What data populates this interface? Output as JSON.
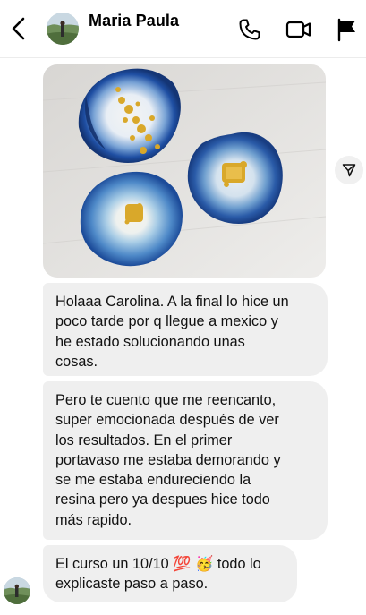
{
  "header": {
    "contact_name": "Maria Paula",
    "icons": {
      "back": "chevron-left-icon",
      "call": "phone-icon",
      "video": "video-camera-icon",
      "report": "flag-icon"
    }
  },
  "thread": {
    "photo": {
      "description_icon": "resin-coasters-photo",
      "share_icon": "send-icon"
    },
    "messages": [
      {
        "text": "Holaaa Carolina. A la final lo hice un\npoco tarde por q llegue a mexico y\nhe estado solucionando unas\ncosas."
      },
      {
        "text": "Pero te cuento que me reencanto,\nsuper emocionada después de ver\nlos resultados. En el primer\nportavaso me estaba demorando y\nse me estaba endureciendo la\nresina pero ya despues hice todo\nmás rapido."
      },
      {
        "text": "El curso un 10/10 💯 🥳 todo lo\nexplicaste paso a paso."
      }
    ]
  },
  "colors": {
    "bubble_bg": "#efefef",
    "coaster_blue": "#1f4fa3",
    "gold_leaf": "#d9a82a"
  }
}
